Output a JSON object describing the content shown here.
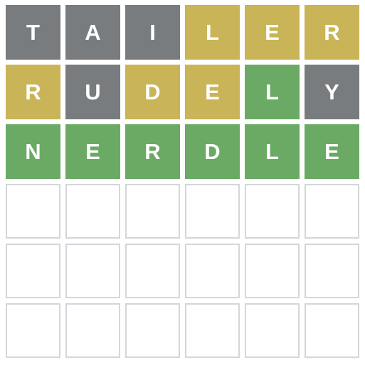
{
  "colors": {
    "absent": "#787c7e",
    "present": "#c9b458",
    "correct": "#6aaa64",
    "empty_border": "#d3d6da",
    "letter": "#ffffff"
  },
  "board": {
    "rows": [
      {
        "letters": [
          "T",
          "A",
          "I",
          "L",
          "E",
          "R"
        ],
        "states": [
          "absent",
          "absent",
          "absent",
          "present",
          "present",
          "present"
        ]
      },
      {
        "letters": [
          "R",
          "U",
          "D",
          "E",
          "L",
          "Y"
        ],
        "states": [
          "present",
          "absent",
          "present",
          "present",
          "correct",
          "absent"
        ]
      },
      {
        "letters": [
          "N",
          "E",
          "R",
          "D",
          "L",
          "E"
        ],
        "states": [
          "correct",
          "correct",
          "correct",
          "correct",
          "correct",
          "correct"
        ]
      },
      {
        "letters": [
          "",
          "",
          "",
          "",
          "",
          ""
        ],
        "states": [
          "empty",
          "empty",
          "empty",
          "empty",
          "empty",
          "empty"
        ]
      },
      {
        "letters": [
          "",
          "",
          "",
          "",
          "",
          ""
        ],
        "states": [
          "empty",
          "empty",
          "empty",
          "empty",
          "empty",
          "empty"
        ]
      },
      {
        "letters": [
          "",
          "",
          "",
          "",
          "",
          ""
        ],
        "states": [
          "empty",
          "empty",
          "empty",
          "empty",
          "empty",
          "empty"
        ]
      }
    ]
  }
}
